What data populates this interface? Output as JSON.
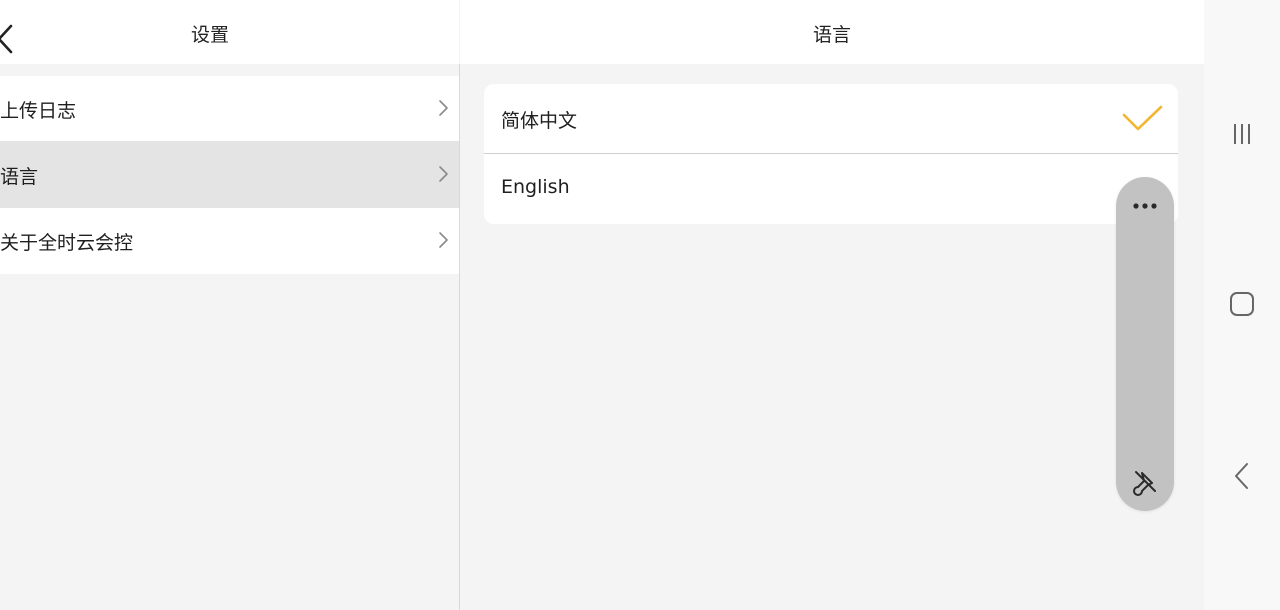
{
  "left_header": {
    "title": "设置"
  },
  "right_header": {
    "title": "语言"
  },
  "settings": {
    "items": [
      {
        "label": "上传日志",
        "selected": false
      },
      {
        "label": "语言",
        "selected": true
      },
      {
        "label": "关于全时云会控",
        "selected": false
      }
    ]
  },
  "language": {
    "options": [
      {
        "label": "简体中文",
        "checked": true
      },
      {
        "label": "English",
        "checked": false
      }
    ]
  },
  "colors": {
    "accent_check": "#f2b632",
    "selected_row": "#e4e4e4",
    "pill": "#c2c2c2"
  },
  "icons": {
    "back": "chevron-left-icon",
    "row_chevron": "chevron-right-icon",
    "check": "checkmark-icon",
    "more": "more-dots-icon",
    "unpin": "unpin-icon",
    "recents": "recent-apps-icon",
    "home": "home-icon",
    "sys_back": "back-icon"
  }
}
